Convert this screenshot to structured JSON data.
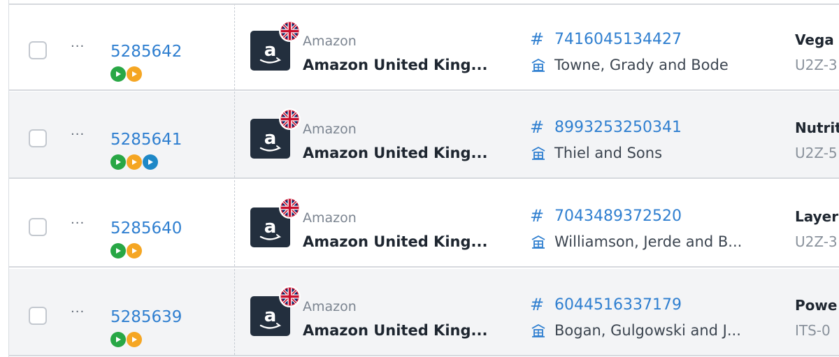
{
  "rows": [
    {
      "order_id": "5285642",
      "statuses": [
        "green",
        "orange"
      ],
      "marketplace_provider": "Amazon",
      "marketplace_name": "Amazon United King...",
      "reference": "7416045134427",
      "supplier": "Towne, Grady and Bode",
      "product": "Vega",
      "sku": "U2Z-3"
    },
    {
      "order_id": "5285641",
      "statuses": [
        "green",
        "orange",
        "blue"
      ],
      "marketplace_provider": "Amazon",
      "marketplace_name": "Amazon United King...",
      "reference": "8993253250341",
      "supplier": "Thiel and Sons",
      "product": "Nutrit",
      "sku": "U2Z-5"
    },
    {
      "order_id": "5285640",
      "statuses": [
        "green",
        "orange"
      ],
      "marketplace_provider": "Amazon",
      "marketplace_name": "Amazon United King...",
      "reference": "7043489372520",
      "supplier": "Williamson, Jerde and B...",
      "product": "Layer",
      "sku": "U2Z-3"
    },
    {
      "order_id": "5285639",
      "statuses": [
        "green",
        "orange"
      ],
      "marketplace_provider": "Amazon",
      "marketplace_name": "Amazon United King...",
      "reference": "6044516337179",
      "supplier": "Bogan, Gulgowski and J...",
      "product": "Powe",
      "sku": "ITS-0"
    }
  ],
  "more_label": "···",
  "hash_symbol": "#",
  "colors": {
    "link": "#2f7fd0",
    "status_green": "#28a745",
    "status_orange": "#f5a623",
    "status_blue": "#1e88c7",
    "logo_bg": "#232f3e"
  },
  "icons": {
    "status": "play-icon",
    "flag": "uk-flag-icon",
    "logo": "amazon-logo",
    "warehouse": "warehouse-icon"
  }
}
